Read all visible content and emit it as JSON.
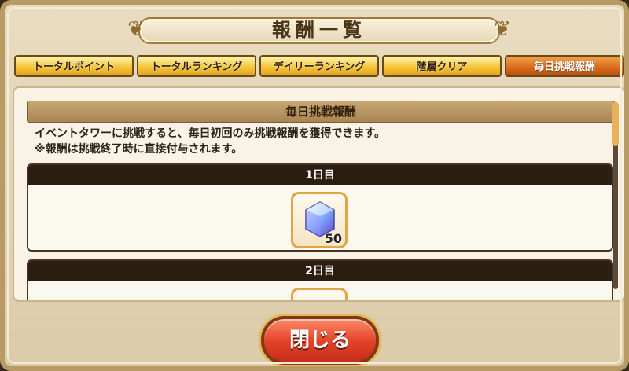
{
  "dialog": {
    "title": "報酬一覧",
    "close_label": "閉じる"
  },
  "tabs": [
    {
      "label": "トータルポイント",
      "active": false
    },
    {
      "label": "トータルランキング",
      "active": false
    },
    {
      "label": "デイリーランキング",
      "active": false
    },
    {
      "label": "階層クリア",
      "active": false
    },
    {
      "label": "毎日挑戦報酬",
      "active": true
    }
  ],
  "section": {
    "header": "毎日挑戦報酬",
    "description_line1": "イベントタワーに挑戦すると、毎日初回のみ挑戦報酬を獲得できます。",
    "description_line2": "※報酬は挑戦終了時に直接付与されます。"
  },
  "days": [
    {
      "label": "1日目",
      "reward": {
        "icon": "crystal-gem-icon",
        "quantity": "50"
      }
    },
    {
      "label": "2日目",
      "reward": {
        "icon": "crystal-gem-icon",
        "quantity": ""
      }
    }
  ],
  "colors": {
    "tab_gold": "#f4c53a",
    "tab_active": "#d86a1c",
    "close_button": "#e3452a",
    "day_header": "#2b1d10"
  }
}
